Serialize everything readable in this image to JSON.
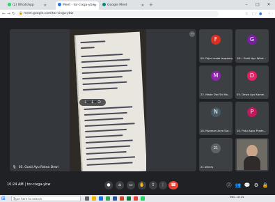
{
  "browser": {
    "tabs": [
      {
        "label": "(2) WhatsApp",
        "color": "#25d366",
        "active": false
      },
      {
        "label": "Meet - tor-cixga-ybw",
        "color": "#1a73e8",
        "active": true
      },
      {
        "label": "Google Meet",
        "color": "#00897b",
        "active": false
      }
    ],
    "new_tab": "+",
    "close_glyph": "×",
    "window_controls": {
      "minimize": "–",
      "maximize": "□",
      "close": "✕"
    },
    "url": "meet.google.com/tor-cixga-ybw",
    "nav": {
      "back": "←",
      "forward": "→",
      "reload": "↻",
      "lock": "🔒"
    }
  },
  "meeting": {
    "presenter_name": "05. Gusti Ayu Ratna Dewi",
    "presenter_more": "⋯",
    "pin_controls": {
      "pin": "⊥",
      "mute": "↓",
      "remove": "⊙"
    },
    "participants": [
      {
        "label": "04. Fajar made Isuparma",
        "avatar_letter": "F",
        "avatar_color": "#d93025"
      },
      {
        "label": "16. I Gusti Ayu Wind...",
        "avatar_letter": "G",
        "avatar_color": "#7b1fa2"
      },
      {
        "label": "22. Made Dwi Sri Ma...",
        "avatar_letter": "M",
        "avatar_color": "#8e24aa"
      },
      {
        "label": "03. Dewa Ayu Kamel...",
        "avatar_letter": "D",
        "avatar_color": "#e91e63"
      },
      {
        "label": "28. Nyoman Arya Sur...",
        "avatar_letter": "N",
        "avatar_color": "#455a64"
      },
      {
        "label": "10. Putu Agus Pradn...",
        "avatar_letter": "P",
        "avatar_color": "#c2185b"
      },
      {
        "label": "21 others",
        "avatar_letter": "21",
        "avatar_color": "#5f6368"
      }
    ],
    "time": "10:24 AM",
    "separator": "|",
    "meeting_code": "tor-cixga-ybw",
    "controls": {
      "mic": "●",
      "cam": "⌂",
      "captions": "▭",
      "raise": "✋",
      "present": "⇪",
      "more": "⋮",
      "end": "☎"
    },
    "right_controls": {
      "info": "ⓘ",
      "people": "👥",
      "chat": "💬",
      "activities": "⚙",
      "host": "🔒"
    }
  },
  "taskbar": {
    "start": "⊞",
    "search_placeholder": "Type here to search",
    "tray_time": "10:24",
    "tray_lang": "ENG"
  },
  "colors": {
    "meet_bg": "#202124",
    "tile_bg": "#3c4043",
    "end_call": "#ea4335",
    "accent": "#1a73e8"
  }
}
